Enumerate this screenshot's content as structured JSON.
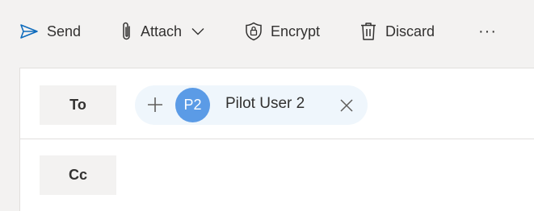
{
  "toolbar": {
    "send_label": "Send",
    "send_icon": "send-icon",
    "attach_label": "Attach",
    "attach_icon": "paperclip-icon",
    "attach_dropdown_icon": "chevron-down-icon",
    "encrypt_label": "Encrypt",
    "encrypt_icon": "shield-lock-icon",
    "discard_label": "Discard",
    "discard_icon": "trash-icon",
    "more_label": "···",
    "icon_color": "#0f6cbd"
  },
  "compose": {
    "to_label": "To",
    "cc_label": "Cc",
    "recipients": [
      {
        "initials": "P2",
        "name": "Pilot User 2",
        "avatar_color": "#5b9be6"
      }
    ]
  }
}
